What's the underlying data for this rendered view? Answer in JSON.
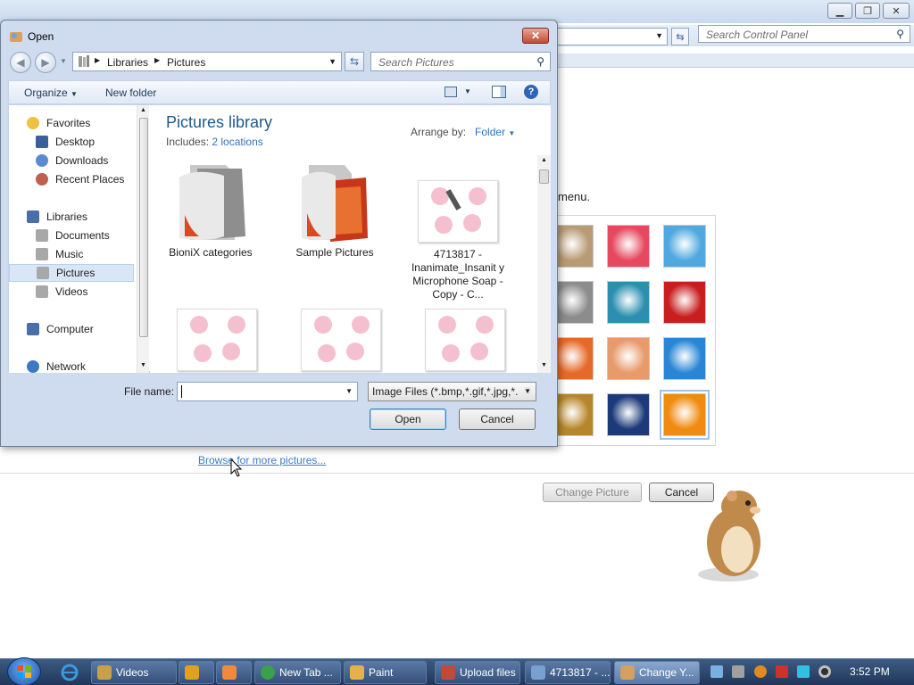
{
  "background_window": {
    "search_placeholder": "Search Control Panel",
    "menu_text": "menu.",
    "browse_link": "Browse for more pictures...",
    "change_picture_label": "Change Picture",
    "cancel_label": "Cancel",
    "gallery_thumbs": [
      {
        "name": "cat",
        "color": "#b89a74"
      },
      {
        "name": "flower",
        "color": "#e6495f"
      },
      {
        "name": "ferris-wheel",
        "color": "#4fa8e0"
      },
      {
        "name": "jacks",
        "color": "#8c8c8c"
      },
      {
        "name": "stairs",
        "color": "#2c8fb0"
      },
      {
        "name": "origami-crane",
        "color": "#c81e1e"
      },
      {
        "name": "hot-air-balloon",
        "color": "#e56a2a"
      },
      {
        "name": "ornament",
        "color": "#e79a6a"
      },
      {
        "name": "sailboat",
        "color": "#2a86d4"
      },
      {
        "name": "wicker",
        "color": "#b8862a"
      },
      {
        "name": "lighthouse",
        "color": "#1c3a7a"
      },
      {
        "name": "orange-daisy",
        "color": "#f08a10"
      }
    ]
  },
  "dialog": {
    "title": "Open",
    "close_label": "✕",
    "breadcrumb": [
      "Libraries",
      "Pictures"
    ],
    "search_placeholder": "Search Pictures",
    "toolbar": {
      "organize": "Organize",
      "new_folder": "New folder"
    },
    "nav": {
      "favorites": "Favorites",
      "desktop": "Desktop",
      "downloads": "Downloads",
      "recent_places": "Recent Places",
      "libraries": "Libraries",
      "documents": "Documents",
      "music": "Music",
      "pictures": "Pictures",
      "videos": "Videos",
      "computer": "Computer",
      "network": "Network"
    },
    "library_title": "Pictures library",
    "includes_label": "Includes:",
    "includes_link": "2 locations",
    "arrange_label": "Arrange by:",
    "arrange_value": "Folder",
    "items": [
      {
        "label": "BioniX categories"
      },
      {
        "label": "Sample Pictures"
      },
      {
        "label": "4713817 - Inanimate_Insanit y Microphone Soap - Copy - C..."
      }
    ],
    "file_name_label": "File name:",
    "file_name_value": "",
    "filter_value": "Image Files (*.bmp,*.gif,*.jpg,*.",
    "open_label": "Open",
    "cancel_label": "Cancel"
  },
  "taskbar": {
    "tasks": [
      {
        "label": "Videos",
        "icon_color": "#c9a04a"
      },
      {
        "label": "",
        "icon_color": "#e0a020"
      },
      {
        "label": "",
        "icon_color": "#f08a3a"
      },
      {
        "label": "New Tab ...",
        "icon_color": "#3aa04a"
      },
      {
        "label": "Paint",
        "icon_color": "#e6b04a"
      },
      {
        "label": "Upload files",
        "icon_color": "#c04a3a"
      },
      {
        "label": "4713817 - ...",
        "icon_color": "#7aa0d0"
      },
      {
        "label": "Change Y...",
        "icon_color": "#d4a060"
      }
    ],
    "clock": "3:52 PM"
  }
}
